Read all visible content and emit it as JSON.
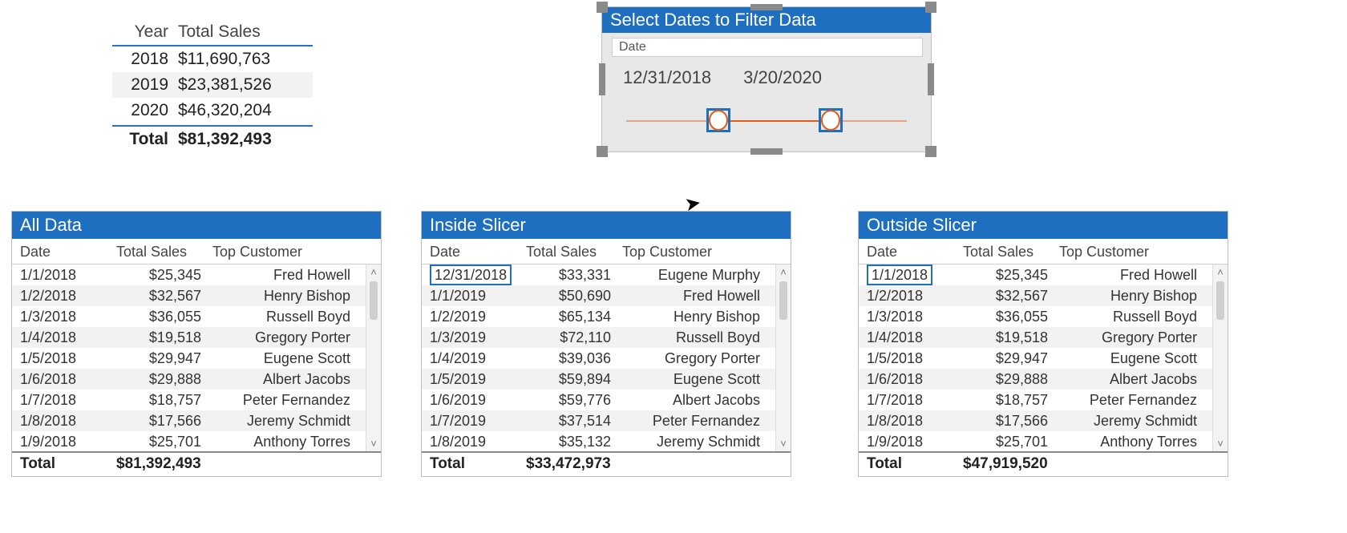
{
  "summary": {
    "headers": {
      "year": "Year",
      "sales": "Total Sales"
    },
    "rows": [
      {
        "year": "2018",
        "sales": "$11,690,763"
      },
      {
        "year": "2019",
        "sales": "$23,381,526"
      },
      {
        "year": "2020",
        "sales": "$46,320,204"
      }
    ],
    "total_label": "Total",
    "total_value": "$81,392,493"
  },
  "slicer": {
    "title": "Select Dates to Filter Data",
    "field_label": "Date",
    "start": "12/31/2018",
    "end": "3/20/2020"
  },
  "tables": {
    "all": {
      "title": "All Data",
      "columns": {
        "date": "Date",
        "sales": "Total Sales",
        "customer": "Top Customer"
      },
      "highlight_first": false,
      "rows": [
        {
          "date": "1/1/2018",
          "sales": "$25,345",
          "customer": "Fred Howell"
        },
        {
          "date": "1/2/2018",
          "sales": "$32,567",
          "customer": "Henry Bishop"
        },
        {
          "date": "1/3/2018",
          "sales": "$36,055",
          "customer": "Russell Boyd"
        },
        {
          "date": "1/4/2018",
          "sales": "$19,518",
          "customer": "Gregory Porter"
        },
        {
          "date": "1/5/2018",
          "sales": "$29,947",
          "customer": "Eugene Scott"
        },
        {
          "date": "1/6/2018",
          "sales": "$29,888",
          "customer": "Albert Jacobs"
        },
        {
          "date": "1/7/2018",
          "sales": "$18,757",
          "customer": "Peter Fernandez"
        },
        {
          "date": "1/8/2018",
          "sales": "$17,566",
          "customer": "Jeremy Schmidt"
        },
        {
          "date": "1/9/2018",
          "sales": "$25,701",
          "customer": "Anthony Torres"
        }
      ],
      "total_label": "Total",
      "total_value": "$81,392,493"
    },
    "inside": {
      "title": "Inside Slicer",
      "columns": {
        "date": "Date",
        "sales": "Total Sales",
        "customer": "Top Customer"
      },
      "highlight_first": true,
      "rows": [
        {
          "date": "12/31/2018",
          "sales": "$33,331",
          "customer": "Eugene Murphy"
        },
        {
          "date": "1/1/2019",
          "sales": "$50,690",
          "customer": "Fred Howell"
        },
        {
          "date": "1/2/2019",
          "sales": "$65,134",
          "customer": "Henry Bishop"
        },
        {
          "date": "1/3/2019",
          "sales": "$72,110",
          "customer": "Russell Boyd"
        },
        {
          "date": "1/4/2019",
          "sales": "$39,036",
          "customer": "Gregory Porter"
        },
        {
          "date": "1/5/2019",
          "sales": "$59,894",
          "customer": "Eugene Scott"
        },
        {
          "date": "1/6/2019",
          "sales": "$59,776",
          "customer": "Albert Jacobs"
        },
        {
          "date": "1/7/2019",
          "sales": "$37,514",
          "customer": "Peter Fernandez"
        },
        {
          "date": "1/8/2019",
          "sales": "$35,132",
          "customer": "Jeremy Schmidt"
        }
      ],
      "total_label": "Total",
      "total_value": "$33,472,973"
    },
    "outside": {
      "title": "Outside Slicer",
      "columns": {
        "date": "Date",
        "sales": "Total Sales",
        "customer": "Top Customer"
      },
      "highlight_first": true,
      "rows": [
        {
          "date": "1/1/2018",
          "sales": "$25,345",
          "customer": "Fred Howell"
        },
        {
          "date": "1/2/2018",
          "sales": "$32,567",
          "customer": "Henry Bishop"
        },
        {
          "date": "1/3/2018",
          "sales": "$36,055",
          "customer": "Russell Boyd"
        },
        {
          "date": "1/4/2018",
          "sales": "$19,518",
          "customer": "Gregory Porter"
        },
        {
          "date": "1/5/2018",
          "sales": "$29,947",
          "customer": "Eugene Scott"
        },
        {
          "date": "1/6/2018",
          "sales": "$29,888",
          "customer": "Albert Jacobs"
        },
        {
          "date": "1/7/2018",
          "sales": "$18,757",
          "customer": "Peter Fernandez"
        },
        {
          "date": "1/8/2018",
          "sales": "$17,566",
          "customer": "Jeremy Schmidt"
        },
        {
          "date": "1/9/2018",
          "sales": "$25,701",
          "customer": "Anthony Torres"
        }
      ],
      "total_label": "Total",
      "total_value": "$47,919,520"
    }
  },
  "chart_data": [
    {
      "type": "table",
      "title": "Total Sales by Year",
      "columns": [
        "Year",
        "Total Sales"
      ],
      "rows": [
        [
          "2018",
          11690763
        ],
        [
          "2019",
          23381526
        ],
        [
          "2020",
          46320204
        ]
      ],
      "total": 81392493
    },
    {
      "type": "table",
      "title": "All Data",
      "columns": [
        "Date",
        "Total Sales",
        "Top Customer"
      ],
      "rows": [
        [
          "1/1/2018",
          25345,
          "Fred Howell"
        ],
        [
          "1/2/2018",
          32567,
          "Henry Bishop"
        ],
        [
          "1/3/2018",
          36055,
          "Russell Boyd"
        ],
        [
          "1/4/2018",
          19518,
          "Gregory Porter"
        ],
        [
          "1/5/2018",
          29947,
          "Eugene Scott"
        ],
        [
          "1/6/2018",
          29888,
          "Albert Jacobs"
        ],
        [
          "1/7/2018",
          18757,
          "Peter Fernandez"
        ],
        [
          "1/8/2018",
          17566,
          "Jeremy Schmidt"
        ],
        [
          "1/9/2018",
          25701,
          "Anthony Torres"
        ]
      ],
      "total": 81392493
    },
    {
      "type": "table",
      "title": "Inside Slicer",
      "columns": [
        "Date",
        "Total Sales",
        "Top Customer"
      ],
      "rows": [
        [
          "12/31/2018",
          33331,
          "Eugene Murphy"
        ],
        [
          "1/1/2019",
          50690,
          "Fred Howell"
        ],
        [
          "1/2/2019",
          65134,
          "Henry Bishop"
        ],
        [
          "1/3/2019",
          72110,
          "Russell Boyd"
        ],
        [
          "1/4/2019",
          39036,
          "Gregory Porter"
        ],
        [
          "1/5/2019",
          59894,
          "Eugene Scott"
        ],
        [
          "1/6/2019",
          59776,
          "Albert Jacobs"
        ],
        [
          "1/7/2019",
          37514,
          "Peter Fernandez"
        ],
        [
          "1/8/2019",
          35132,
          "Jeremy Schmidt"
        ]
      ],
      "total": 33472973
    },
    {
      "type": "table",
      "title": "Outside Slicer",
      "columns": [
        "Date",
        "Total Sales",
        "Top Customer"
      ],
      "rows": [
        [
          "1/1/2018",
          25345,
          "Fred Howell"
        ],
        [
          "1/2/2018",
          32567,
          "Henry Bishop"
        ],
        [
          "1/3/2018",
          36055,
          "Russell Boyd"
        ],
        [
          "1/4/2018",
          19518,
          "Gregory Porter"
        ],
        [
          "1/5/2018",
          29947,
          "Eugene Scott"
        ],
        [
          "1/6/2018",
          29888,
          "Albert Jacobs"
        ],
        [
          "1/7/2018",
          18757,
          "Peter Fernandez"
        ],
        [
          "1/8/2018",
          17566,
          "Jeremy Schmidt"
        ],
        [
          "1/9/2018",
          25701,
          "Anthony Torres"
        ]
      ],
      "total": 47919520
    }
  ]
}
